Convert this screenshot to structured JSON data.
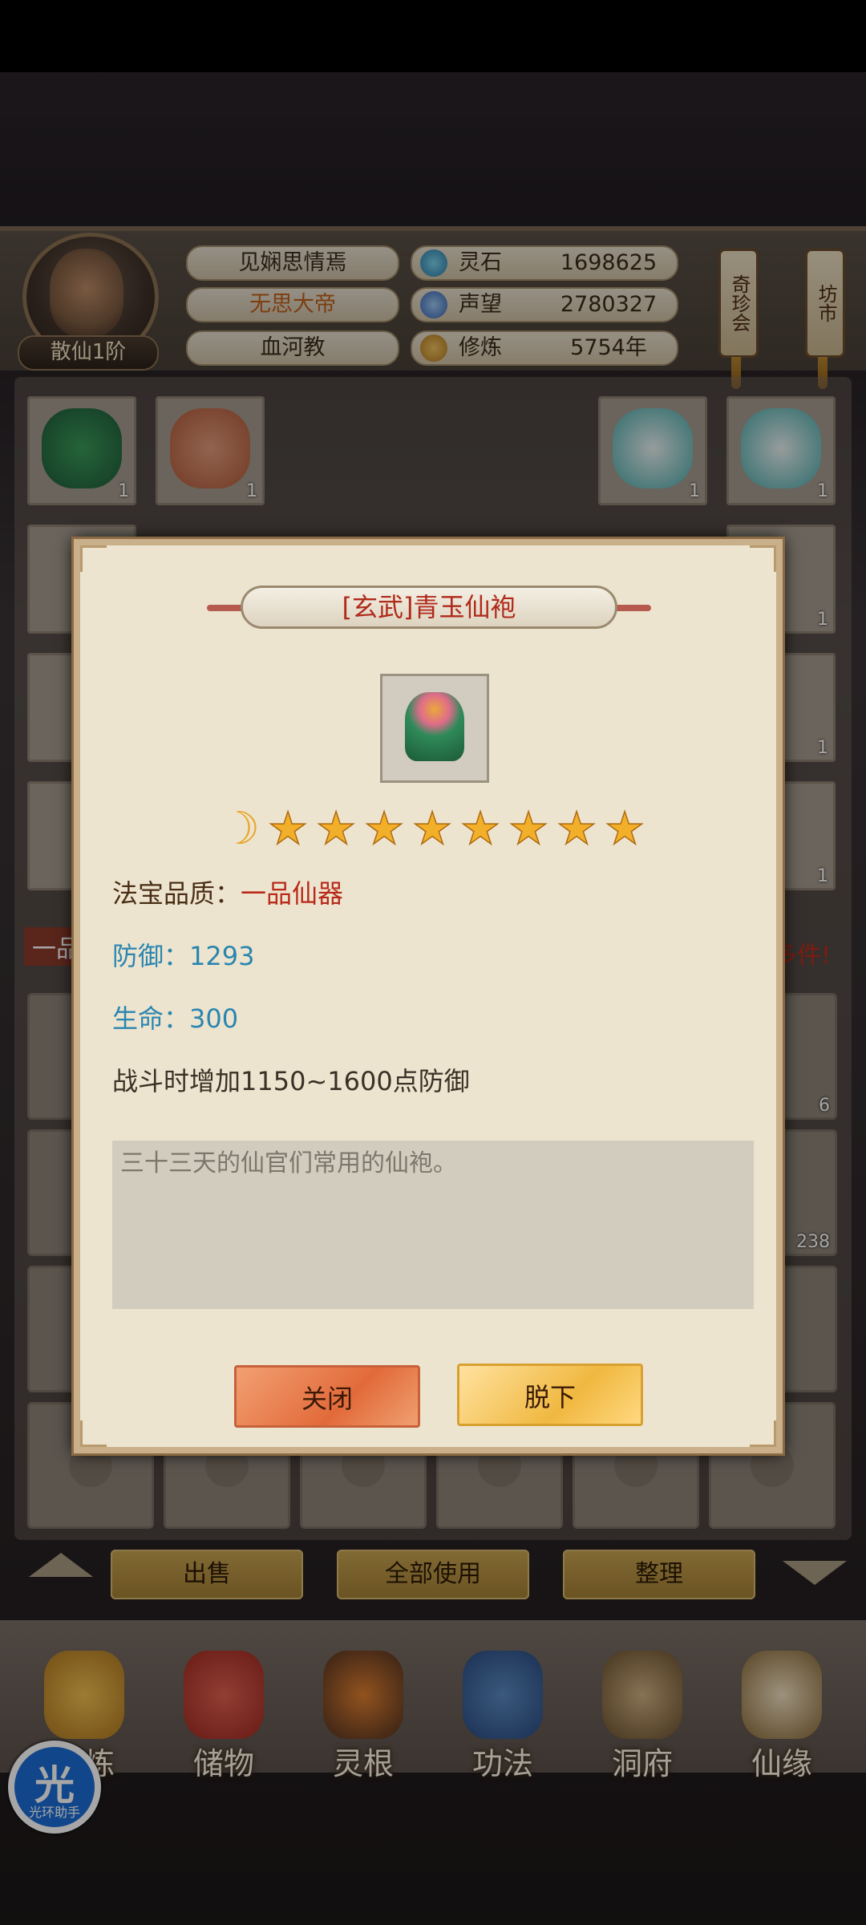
{
  "header": {
    "rank": "散仙1阶",
    "names": [
      "见娴思情焉",
      "无思大帝",
      "血河教"
    ],
    "resources": [
      {
        "icon": "spirit-stone-icon",
        "label": "灵石",
        "value": "1698625"
      },
      {
        "icon": "reputation-icon",
        "label": "声望",
        "value": "2780327"
      },
      {
        "icon": "cultivation-icon",
        "label": "修炼",
        "value": "5754年"
      }
    ],
    "signs": [
      "奇珍会",
      "坊市"
    ]
  },
  "inventory": {
    "counts": [
      "1",
      "1",
      "1",
      "1",
      "1",
      "1",
      "1",
      "6",
      "238"
    ],
    "banner_left": "一品",
    "banner_right": "多件!"
  },
  "actions": {
    "sell": "出售",
    "use_all": "全部使用",
    "organize": "整理"
  },
  "nav": {
    "items": [
      "修炼",
      "储物",
      "灵根",
      "功法",
      "洞府",
      "仙缘"
    ]
  },
  "helper": {
    "char": "光",
    "label": "光环助手"
  },
  "modal": {
    "title": "[玄武]青玉仙袍",
    "stars": 8,
    "quality_label": "法宝品质：",
    "quality_value": "一品仙器",
    "defense": "防御：1293",
    "hp": "生命：300",
    "effect": "战斗时增加1150~1600点防御",
    "description": "三十三天的仙官们常用的仙袍。",
    "close_label": "关闭",
    "unequip_label": "脱下"
  },
  "colors": {
    "title_red": "#b02a1a",
    "stat_blue": "#2a86b0",
    "close_button": "#e26a3a",
    "unequip_button": "#f0b840"
  }
}
